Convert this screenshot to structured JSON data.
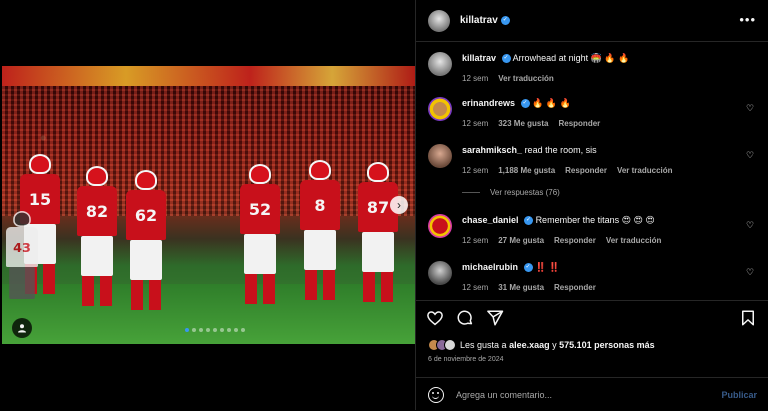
{
  "post": {
    "author": "killatrav",
    "caption_text": "Arrowhead at night 🏟️ 🔥 🔥",
    "caption_time": "12 sem",
    "caption_translate": "Ver traducción",
    "jersey_numbers": [
      "15",
      "82",
      "62",
      "52",
      "8",
      "87",
      "43"
    ]
  },
  "comments": [
    {
      "user": "erinandrews",
      "text": "🔥 🔥 🔥",
      "time": "12 sem",
      "likes": "323 Me gusta",
      "reply": "Responder",
      "translate": ""
    },
    {
      "user": "sarahmiksch_",
      "text": "read the room, sis",
      "time": "12 sem",
      "likes": "1,188 Me gusta",
      "reply": "Responder",
      "translate": "Ver traducción"
    },
    {
      "user": "chase_daniel",
      "text": "Remember the titans 😍 😍 😍",
      "time": "12 sem",
      "likes": "27 Me gusta",
      "reply": "Responder",
      "translate": "Ver traducción"
    },
    {
      "user": "michaelrubin",
      "text": "‼️ ‼️",
      "time": "12 sem",
      "likes": "31 Me gusta",
      "reply": "Responder",
      "translate": ""
    }
  ],
  "replies_label": "Ver respuestas (76)",
  "likes_summary": {
    "prefix": "Les gusta a",
    "user": "alee.xaag",
    "middle": "y",
    "count": "575.101 personas más"
  },
  "date": "6 de noviembre de 2024",
  "comment_input": {
    "placeholder": "Agrega un comentario...",
    "value": ""
  },
  "publish_label": "Publicar",
  "carousel": {
    "slides": 9,
    "active_index": 0
  },
  "colors": {
    "verified": "#3897f0",
    "publish": "#385b8a",
    "muted": "#a8a8a8",
    "background": "#000000"
  },
  "icons": [
    "more-icon",
    "heart-icon",
    "comment-icon",
    "share-icon",
    "save-icon",
    "emoji-icon",
    "tag-people-icon",
    "next-arrow-icon",
    "verified-icon"
  ]
}
